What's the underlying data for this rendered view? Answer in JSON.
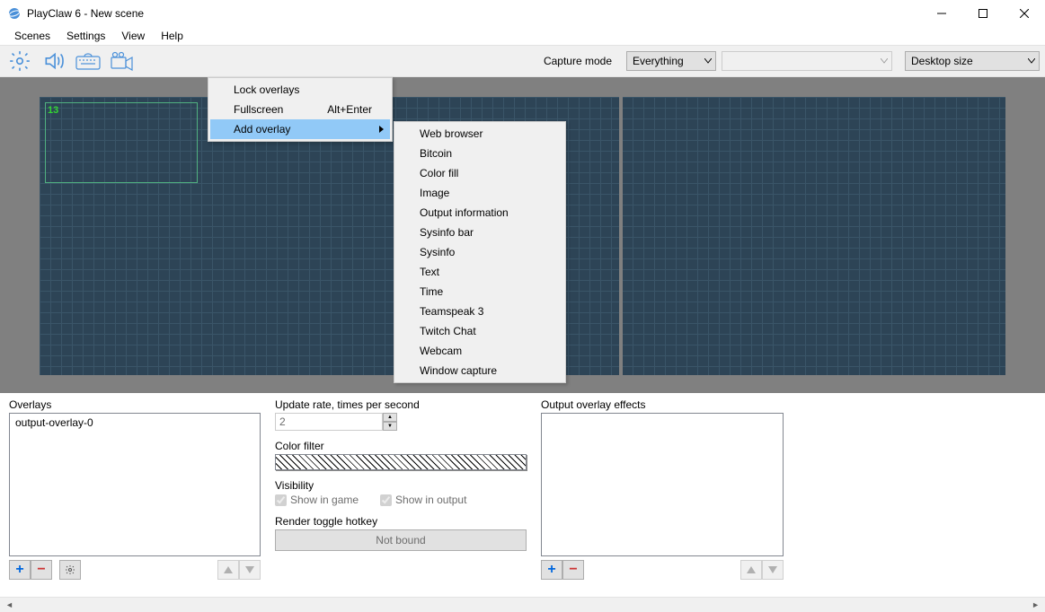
{
  "window": {
    "title": "PlayClaw 6 - New scene"
  },
  "menubar": {
    "items": [
      "Scenes",
      "Settings",
      "View",
      "Help"
    ]
  },
  "toolbar": {
    "capture_label": "Capture mode",
    "dropdown1": {
      "value": "Everything"
    },
    "dropdown2": {
      "value": ""
    },
    "dropdown3": {
      "value": "Desktop size"
    }
  },
  "canvas": {
    "overlay_label": "13"
  },
  "context_menu": {
    "items": [
      {
        "label": "Lock overlays",
        "shortcut": ""
      },
      {
        "label": "Fullscreen",
        "shortcut": "Alt+Enter"
      },
      {
        "label": "Add overlay",
        "shortcut": "",
        "highlight": true,
        "submenu": true
      }
    ],
    "submenu_items": [
      "Web browser",
      "Bitcoin",
      "Color fill",
      "Image",
      "Output information",
      "Sysinfo bar",
      "Sysinfo",
      "Text",
      "Time",
      "Teamspeak 3",
      "Twitch Chat",
      "Webcam",
      "Window capture"
    ]
  },
  "panels": {
    "overlays": {
      "label": "Overlays",
      "items": [
        "output-overlay-0"
      ]
    },
    "properties": {
      "update_rate_label": "Update rate, times per second",
      "update_rate_value": "2",
      "color_filter_label": "Color filter",
      "visibility_label": "Visibility",
      "show_in_game": "Show in game",
      "show_in_output": "Show in output",
      "render_hotkey_label": "Render toggle hotkey",
      "render_hotkey_value": "Not bound"
    },
    "effects": {
      "label": "Output overlay effects"
    }
  }
}
